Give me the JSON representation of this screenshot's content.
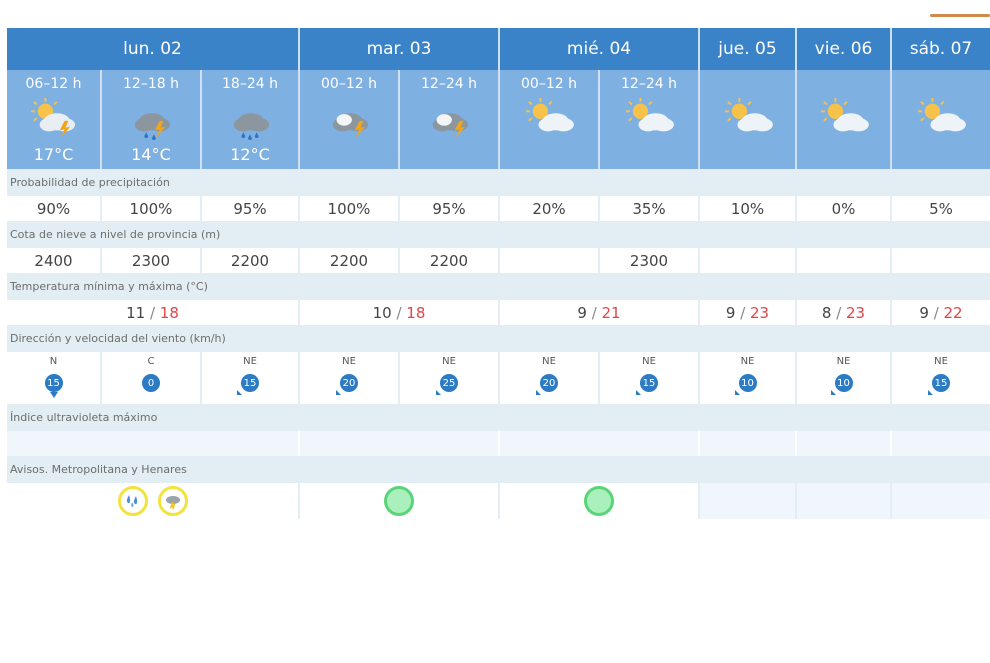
{
  "days": [
    {
      "label": "lun. 02"
    },
    {
      "label": "mar. 03"
    },
    {
      "label": "mié. 04"
    },
    {
      "label": "jue. 05"
    },
    {
      "label": "vie. 06"
    },
    {
      "label": "sáb. 07"
    }
  ],
  "periods": [
    {
      "label": "06–12 h",
      "temp": "17°C",
      "icon": "sun-cloud-storm-icon"
    },
    {
      "label": "12–18 h",
      "temp": "14°C",
      "icon": "cloud-storm-rain-icon"
    },
    {
      "label": "18–24 h",
      "temp": "12°C",
      "icon": "cloud-rain-icon"
    },
    {
      "label": "00–12 h",
      "temp": "",
      "icon": "cloud-storm-icon"
    },
    {
      "label": "12–24 h",
      "temp": "",
      "icon": "cloud-storm-icon"
    },
    {
      "label": "00–12 h",
      "temp": "",
      "icon": "sun-cloud-icon"
    },
    {
      "label": "12–24 h",
      "temp": "",
      "icon": "sun-cloud-icon"
    },
    {
      "label": "",
      "temp": "",
      "icon": "sun-cloud-icon"
    },
    {
      "label": "",
      "temp": "",
      "icon": "sun-cloud-icon"
    },
    {
      "label": "",
      "temp": "",
      "icon": "sun-cloud-icon"
    }
  ],
  "labels": {
    "precip": "Probabilidad de precipitación",
    "snow": "Cota de nieve a nivel de provincia (m)",
    "temp": "Temperatura mínima y máxima (°C)",
    "wind": "Dirección y velocidad del viento (km/h)",
    "uv": "Índice ultravioleta máximo",
    "warn": "Avisos. Metropolitana y Henares"
  },
  "precip": [
    "90%",
    "100%",
    "95%",
    "100%",
    "95%",
    "20%",
    "35%",
    "10%",
    "0%",
    "5%"
  ],
  "snow": [
    "2400",
    "2300",
    "2200",
    "2200",
    "2200",
    "",
    "2300",
    "",
    "",
    ""
  ],
  "minmax": [
    {
      "min": "11",
      "max": "18"
    },
    {
      "min": "10",
      "max": "18"
    },
    {
      "min": "9",
      "max": "21"
    },
    {
      "min": "9",
      "max": "23"
    },
    {
      "min": "8",
      "max": "23"
    },
    {
      "min": "9",
      "max": "22"
    }
  ],
  "wind": [
    {
      "dir": "N",
      "speed": "15"
    },
    {
      "dir": "C",
      "speed": "0"
    },
    {
      "dir": "NE",
      "speed": "15"
    },
    {
      "dir": "NE",
      "speed": "20"
    },
    {
      "dir": "NE",
      "speed": "25"
    },
    {
      "dir": "NE",
      "speed": "20"
    },
    {
      "dir": "NE",
      "speed": "15"
    },
    {
      "dir": "NE",
      "speed": "10"
    },
    {
      "dir": "NE",
      "speed": "10"
    },
    {
      "dir": "NE",
      "speed": "15"
    }
  ],
  "colors": {
    "header": "#3a83c9",
    "subheader": "#7fb0e2",
    "max": "#e34545",
    "warn_yellow": "#f2e33b",
    "warn_green": "#5ad47a"
  }
}
